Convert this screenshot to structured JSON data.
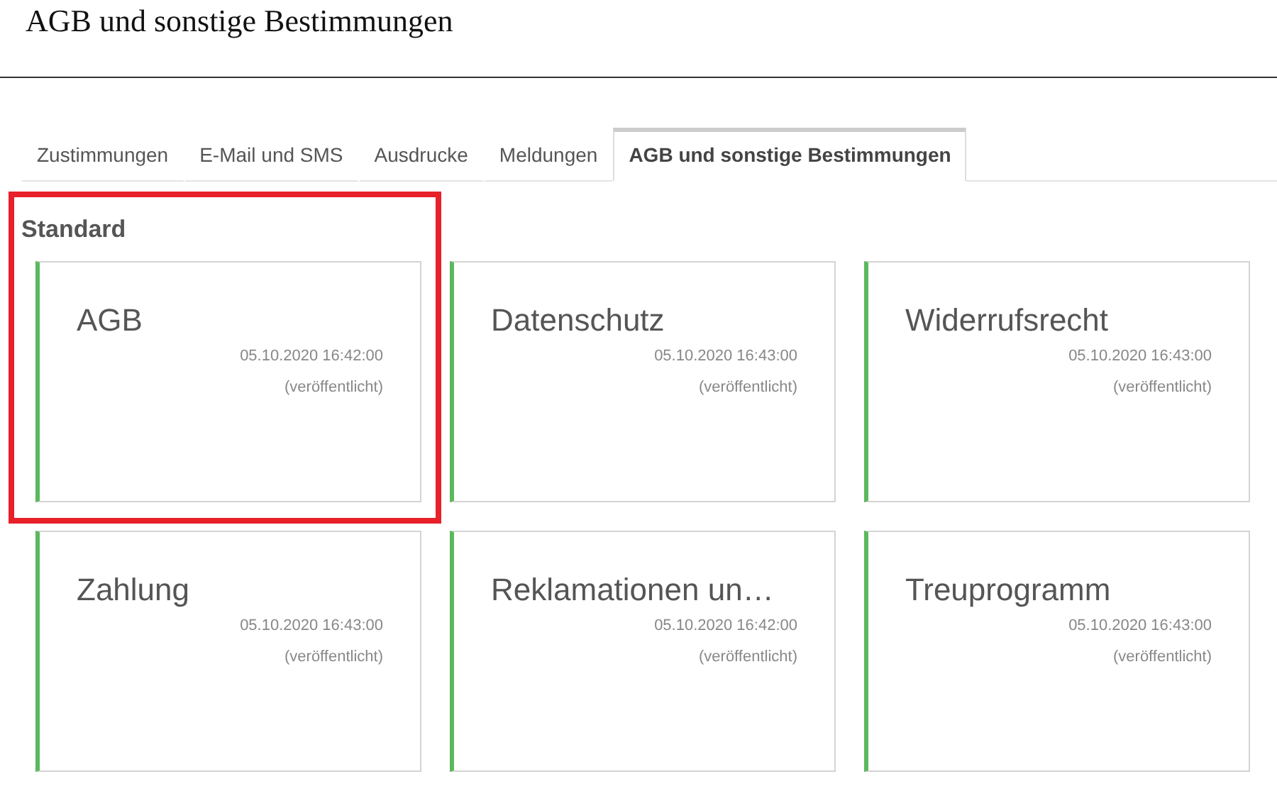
{
  "page_title": "AGB und sonstige Bestimmungen",
  "tabs": [
    {
      "label": "Zustimmungen",
      "selected": false
    },
    {
      "label": "E-Mail und SMS",
      "selected": false
    },
    {
      "label": "Ausdrucke",
      "selected": false
    },
    {
      "label": "Meldungen",
      "selected": false
    },
    {
      "label": "AGB und sonstige Bestimmungen",
      "selected": true
    }
  ],
  "section": {
    "heading": "Standard",
    "highlighted": true,
    "cards": [
      {
        "title": "AGB",
        "date": "05.10.2020 16:42:00",
        "status": "(veröffentlicht)"
      },
      {
        "title": "Datenschutz",
        "date": "05.10.2020 16:43:00",
        "status": "(veröffentlicht)"
      },
      {
        "title": "Widerrufsrecht",
        "date": "05.10.2020 16:43:00",
        "status": "(veröffentlicht)"
      },
      {
        "title": "Zahlung",
        "date": "05.10.2020 16:43:00",
        "status": "(veröffentlicht)"
      },
      {
        "title": "Reklamationen un…",
        "date": "05.10.2020 16:42:00",
        "status": "(veröffentlicht)"
      },
      {
        "title": "Treuprogramm",
        "date": "05.10.2020 16:43:00",
        "status": "(veröffentlicht)"
      }
    ]
  }
}
